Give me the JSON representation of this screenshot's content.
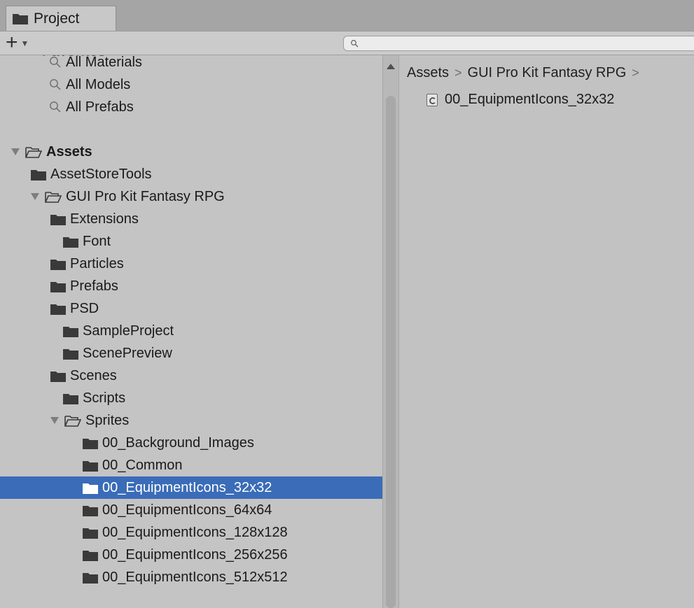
{
  "window": {
    "tab_label": "Project",
    "tab_icon": "folder-icon"
  },
  "toolbar": {
    "create_label": "+",
    "create_icon": "plus-icon",
    "search_placeholder": ""
  },
  "tree": {
    "favorites_cut_label": "Favorites",
    "favorites": [
      {
        "label": "All Materials",
        "icon": "search-icon"
      },
      {
        "label": "All Models",
        "icon": "search-icon"
      },
      {
        "label": "All Prefabs",
        "icon": "search-icon"
      }
    ],
    "root": {
      "label": "Assets",
      "expanded": true
    },
    "items": [
      {
        "label": "AssetStoreTools",
        "depth": 1,
        "arrow": "right",
        "open": false
      },
      {
        "label": "GUI Pro Kit Fantasy RPG",
        "depth": 1,
        "arrow": "down",
        "open": true
      },
      {
        "label": "Extensions",
        "depth": 2,
        "arrow": "right",
        "open": false
      },
      {
        "label": "Font",
        "depth": 2,
        "arrow": "none",
        "open": false
      },
      {
        "label": "Particles",
        "depth": 2,
        "arrow": "right",
        "open": false
      },
      {
        "label": "Prefabs",
        "depth": 2,
        "arrow": "right",
        "open": false
      },
      {
        "label": "PSD",
        "depth": 2,
        "arrow": "right",
        "open": false
      },
      {
        "label": "SampleProject",
        "depth": 2,
        "arrow": "none",
        "open": false
      },
      {
        "label": "ScenePreview",
        "depth": 2,
        "arrow": "none",
        "open": false
      },
      {
        "label": "Scenes",
        "depth": 2,
        "arrow": "right",
        "open": false
      },
      {
        "label": "Scripts",
        "depth": 2,
        "arrow": "none",
        "open": false
      },
      {
        "label": "Sprites",
        "depth": 2,
        "arrow": "down",
        "open": true
      },
      {
        "label": "00_Background_Images",
        "depth": 3,
        "arrow": "none",
        "open": false
      },
      {
        "label": "00_Common",
        "depth": 3,
        "arrow": "none",
        "open": false
      },
      {
        "label": "00_EquipmentIcons_32x32",
        "depth": 3,
        "arrow": "none",
        "open": false,
        "selected": true
      },
      {
        "label": "00_EquipmentIcons_64x64",
        "depth": 3,
        "arrow": "none",
        "open": false
      },
      {
        "label": "00_EquipmentIcons_128x128",
        "depth": 3,
        "arrow": "none",
        "open": false
      },
      {
        "label": "00_EquipmentIcons_256x256",
        "depth": 3,
        "arrow": "none",
        "open": false
      },
      {
        "label": "00_EquipmentIcons_512x512",
        "depth": 3,
        "arrow": "none",
        "open": false
      }
    ]
  },
  "right_pane": {
    "breadcrumb": [
      "Assets",
      "GUI Pro Kit Fantasy RPG"
    ],
    "breadcrumb_separator": ">",
    "files": [
      {
        "label": "00_EquipmentIcons_32x32",
        "icon": "sprite-asset-icon"
      }
    ]
  },
  "colors": {
    "selection": "#3a6cb8",
    "panel_bg": "#c2c2c2",
    "tab_strip": "#a5a5a5"
  }
}
